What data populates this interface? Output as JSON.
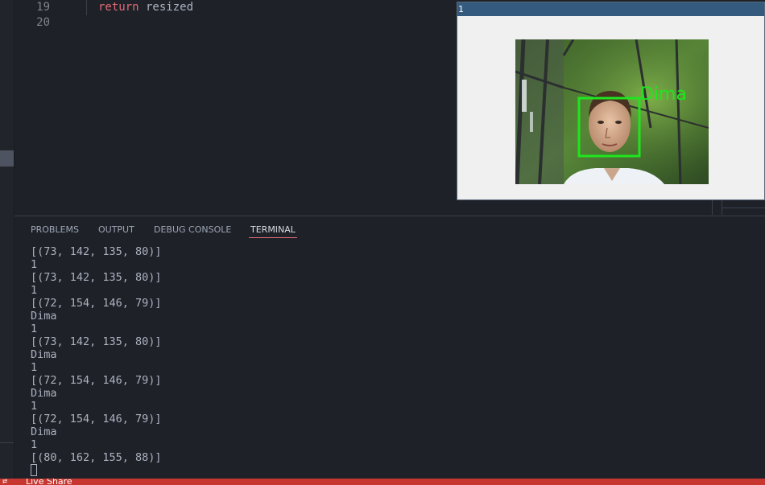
{
  "editor": {
    "lines": [
      {
        "number": "19",
        "keyword": "return",
        "text": " resized"
      },
      {
        "number": "20",
        "keyword": "",
        "text": ""
      }
    ]
  },
  "image_window": {
    "title": "1",
    "label": "Dima",
    "box_color": "#1ee61e"
  },
  "panel": {
    "tabs": [
      "PROBLEMS",
      "OUTPUT",
      "DEBUG CONSOLE",
      "TERMINAL"
    ],
    "active_tab": "TERMINAL",
    "terminal_lines": [
      "[(73, 142, 135, 80)]",
      "1",
      "[(73, 142, 135, 80)]",
      "1",
      "[(72, 154, 146, 79)]",
      "Dima",
      "1",
      "[(73, 142, 135, 80)]",
      "Dima",
      "1",
      "[(72, 154, 146, 79)]",
      "Dima",
      "1",
      "[(72, 154, 146, 79)]",
      "Dima",
      "1",
      "[(80, 162, 155, 88)]"
    ]
  },
  "statusbar": {
    "text": "Live Share",
    "color": "#c7362f"
  }
}
